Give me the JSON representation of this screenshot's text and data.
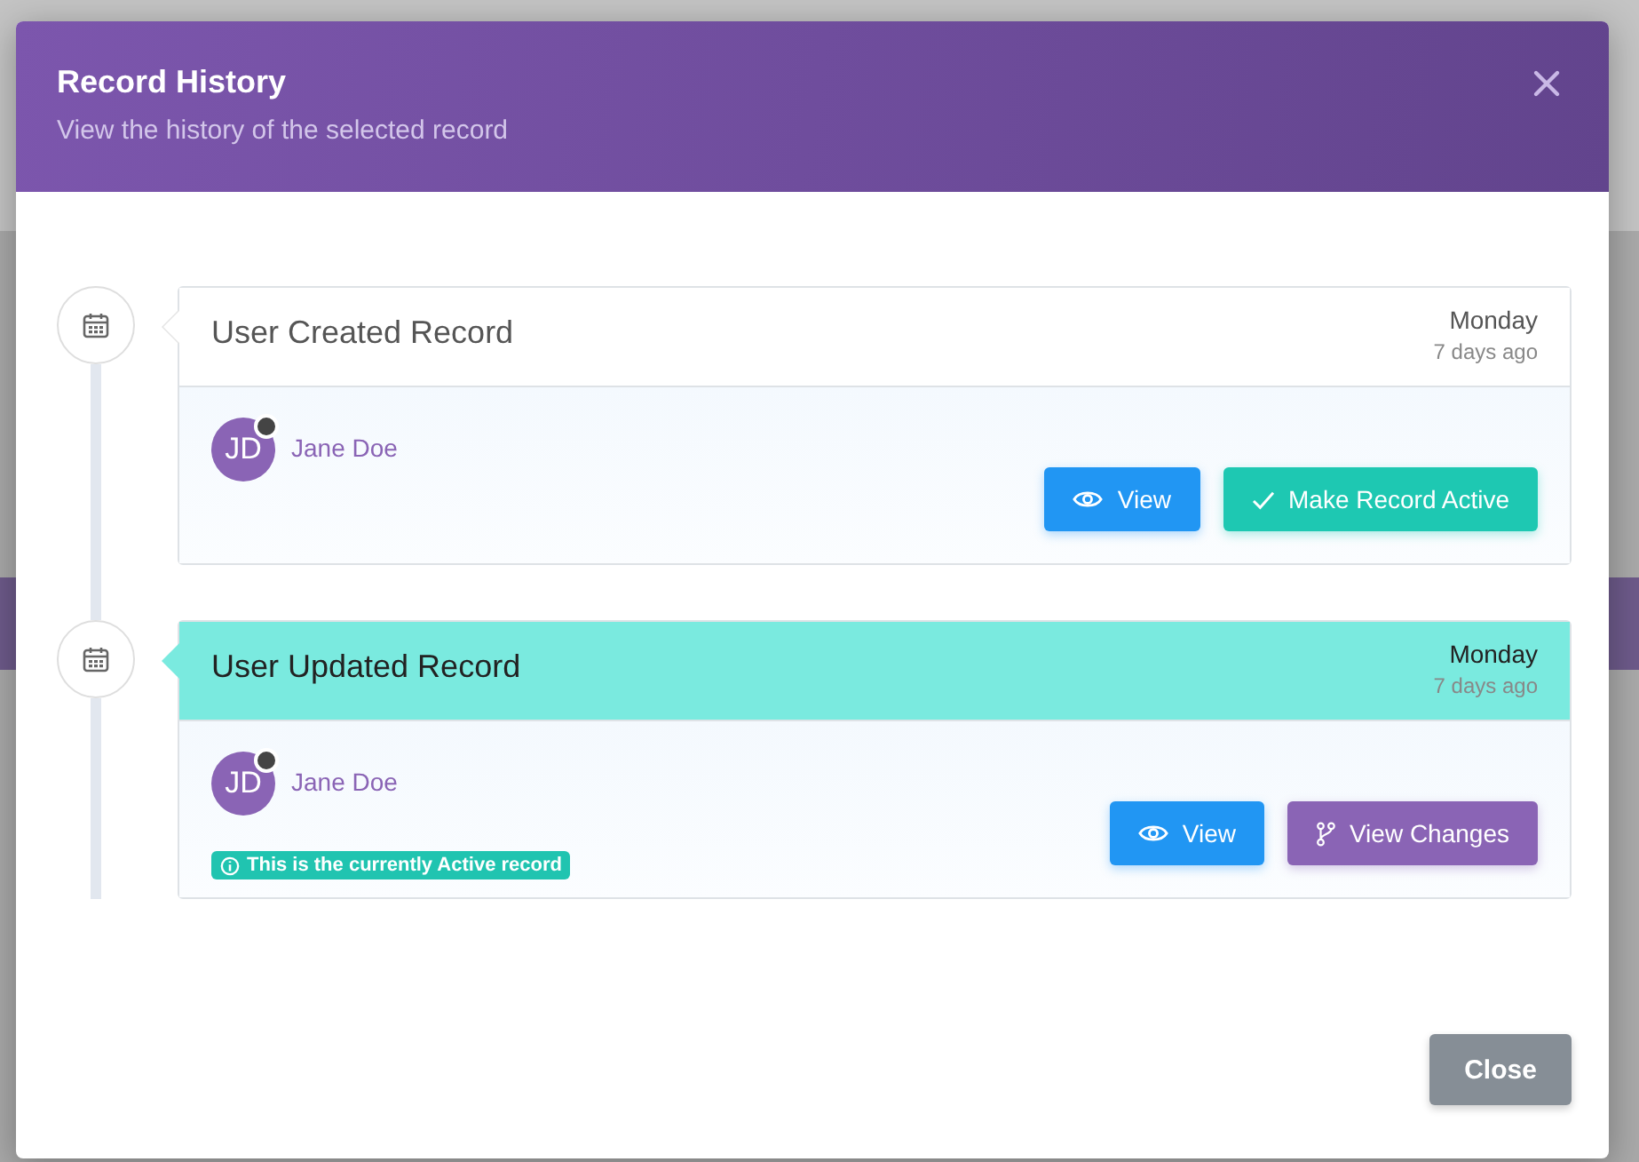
{
  "modal": {
    "title": "Record History",
    "subtitle": "View the history of the selected record"
  },
  "entries": [
    {
      "title": "User Created Record",
      "day": "Monday",
      "ago": "7 days ago",
      "user": {
        "initials": "JD",
        "name": "Jane Doe"
      },
      "active": false,
      "buttons": [
        {
          "kind": "view",
          "label": "View"
        },
        {
          "kind": "activate",
          "label": "Make Record Active"
        }
      ]
    },
    {
      "title": "User Updated Record",
      "day": "Monday",
      "ago": "7 days ago",
      "user": {
        "initials": "JD",
        "name": "Jane Doe"
      },
      "active": true,
      "badge": "This is the currently Active record",
      "buttons": [
        {
          "kind": "view",
          "label": "View"
        },
        {
          "kind": "changes",
          "label": "View Changes"
        }
      ]
    }
  ],
  "footer": {
    "close_label": "Close"
  }
}
